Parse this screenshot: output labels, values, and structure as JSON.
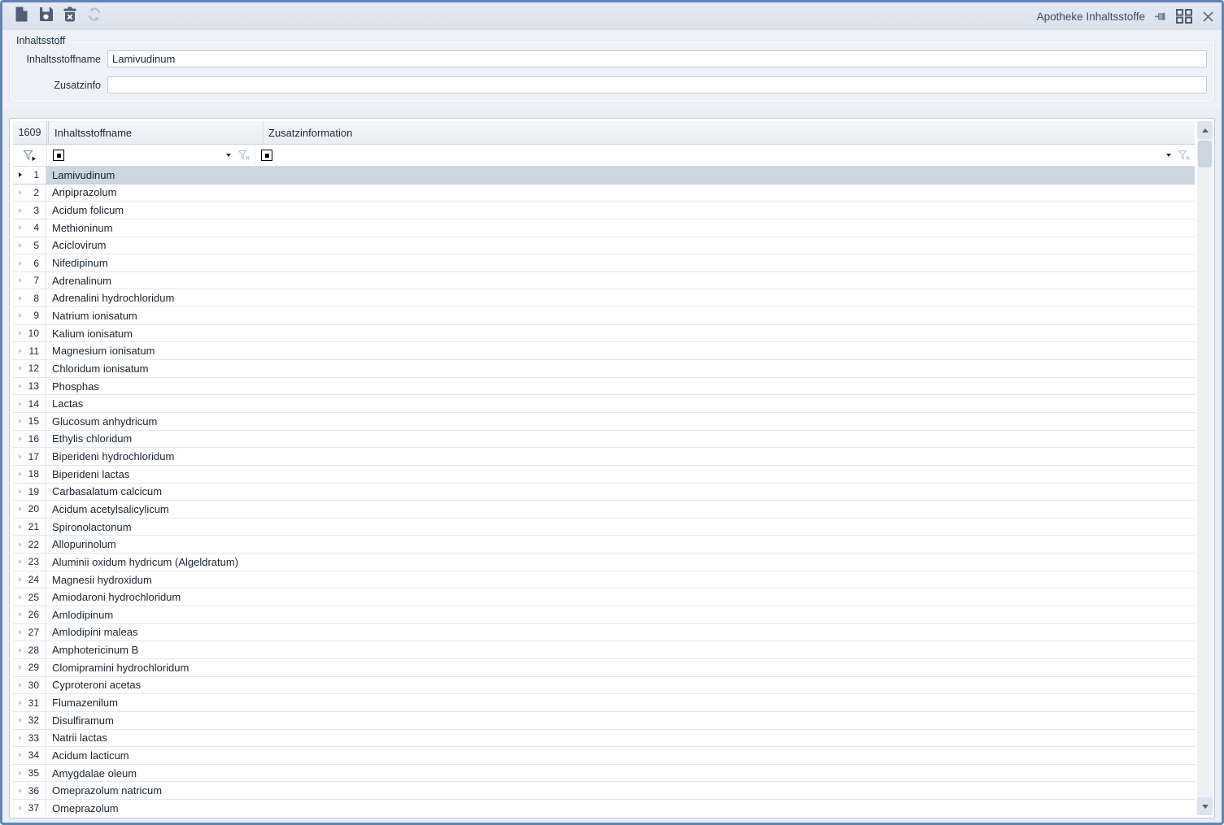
{
  "window": {
    "title": "Apotheke Inhaltsstoffe"
  },
  "toolbar": {
    "icons": [
      "new-document",
      "save",
      "delete",
      "refresh"
    ],
    "refresh_disabled": true
  },
  "titlebar_icons": [
    "pin",
    "tiles",
    "close"
  ],
  "form": {
    "group_label": "Inhaltsstoff",
    "fields": {
      "inhaltsstoffname": {
        "label": "Inhaltsstoffname",
        "value": "Lamivudinum"
      },
      "zusatzinfo": {
        "label": "Zusatzinfo",
        "value": ""
      }
    }
  },
  "grid": {
    "record_count": "1609",
    "columns": {
      "name": "Inhaltsstoffname",
      "zusatz": "Zusatzinformation"
    },
    "filter_icons": [
      "filter-menu",
      "filter-operator",
      "dropdown",
      "clear-filter"
    ],
    "selected_row": 1,
    "rows": [
      {
        "num": "1",
        "name": "Lamivudinum",
        "zusatz": ""
      },
      {
        "num": "2",
        "name": "Aripiprazolum",
        "zusatz": ""
      },
      {
        "num": "3",
        "name": "Acidum folicum",
        "zusatz": ""
      },
      {
        "num": "4",
        "name": "Methioninum",
        "zusatz": ""
      },
      {
        "num": "5",
        "name": "Aciclovirum",
        "zusatz": ""
      },
      {
        "num": "6",
        "name": "Nifedipinum",
        "zusatz": ""
      },
      {
        "num": "7",
        "name": "Adrenalinum",
        "zusatz": ""
      },
      {
        "num": "8",
        "name": "Adrenalini hydrochloridum",
        "zusatz": ""
      },
      {
        "num": "9",
        "name": "Natrium ionisatum",
        "zusatz": ""
      },
      {
        "num": "10",
        "name": "Kalium ionisatum",
        "zusatz": ""
      },
      {
        "num": "11",
        "name": "Magnesium ionisatum",
        "zusatz": ""
      },
      {
        "num": "12",
        "name": "Chloridum ionisatum",
        "zusatz": ""
      },
      {
        "num": "13",
        "name": "Phosphas",
        "zusatz": ""
      },
      {
        "num": "14",
        "name": "Lactas",
        "zusatz": ""
      },
      {
        "num": "15",
        "name": "Glucosum anhydricum",
        "zusatz": ""
      },
      {
        "num": "16",
        "name": "Ethylis chloridum",
        "zusatz": ""
      },
      {
        "num": "17",
        "name": "Biperideni hydrochloridum",
        "zusatz": ""
      },
      {
        "num": "18",
        "name": "Biperideni lactas",
        "zusatz": ""
      },
      {
        "num": "19",
        "name": "Carbasalatum calcicum",
        "zusatz": ""
      },
      {
        "num": "20",
        "name": "Acidum acetylsalicylicum",
        "zusatz": ""
      },
      {
        "num": "21",
        "name": "Spironolactonum",
        "zusatz": ""
      },
      {
        "num": "22",
        "name": "Allopurinolum",
        "zusatz": ""
      },
      {
        "num": "23",
        "name": "Aluminii oxidum hydricum (Algeldratum)",
        "zusatz": ""
      },
      {
        "num": "24",
        "name": "Magnesii hydroxidum",
        "zusatz": ""
      },
      {
        "num": "25",
        "name": "Amiodaroni hydrochloridum",
        "zusatz": ""
      },
      {
        "num": "26",
        "name": "Amlodipinum",
        "zusatz": ""
      },
      {
        "num": "27",
        "name": "Amlodipini maleas",
        "zusatz": ""
      },
      {
        "num": "28",
        "name": "Amphotericinum B",
        "zusatz": ""
      },
      {
        "num": "29",
        "name": "Clomipramini hydrochloridum",
        "zusatz": ""
      },
      {
        "num": "30",
        "name": "Cyproteroni acetas",
        "zusatz": ""
      },
      {
        "num": "31",
        "name": "Flumazenilum",
        "zusatz": ""
      },
      {
        "num": "32",
        "name": "Disulfiramum",
        "zusatz": ""
      },
      {
        "num": "33",
        "name": "Natrii lactas",
        "zusatz": ""
      },
      {
        "num": "34",
        "name": "Acidum lacticum",
        "zusatz": ""
      },
      {
        "num": "35",
        "name": "Amygdalae oleum",
        "zusatz": ""
      },
      {
        "num": "36",
        "name": "Omeprazolum natricum",
        "zusatz": ""
      },
      {
        "num": "37",
        "name": "Omeprazolum",
        "zusatz": ""
      }
    ]
  },
  "colors": {
    "window_border": "#6083b8",
    "toolbar_bg": "#dde4ee",
    "panel_bg": "#eef2f7",
    "selection_bg": "#ccd5e0",
    "icon_dark": "#4e5e74",
    "icon_disabled": "#b7c1cf"
  }
}
